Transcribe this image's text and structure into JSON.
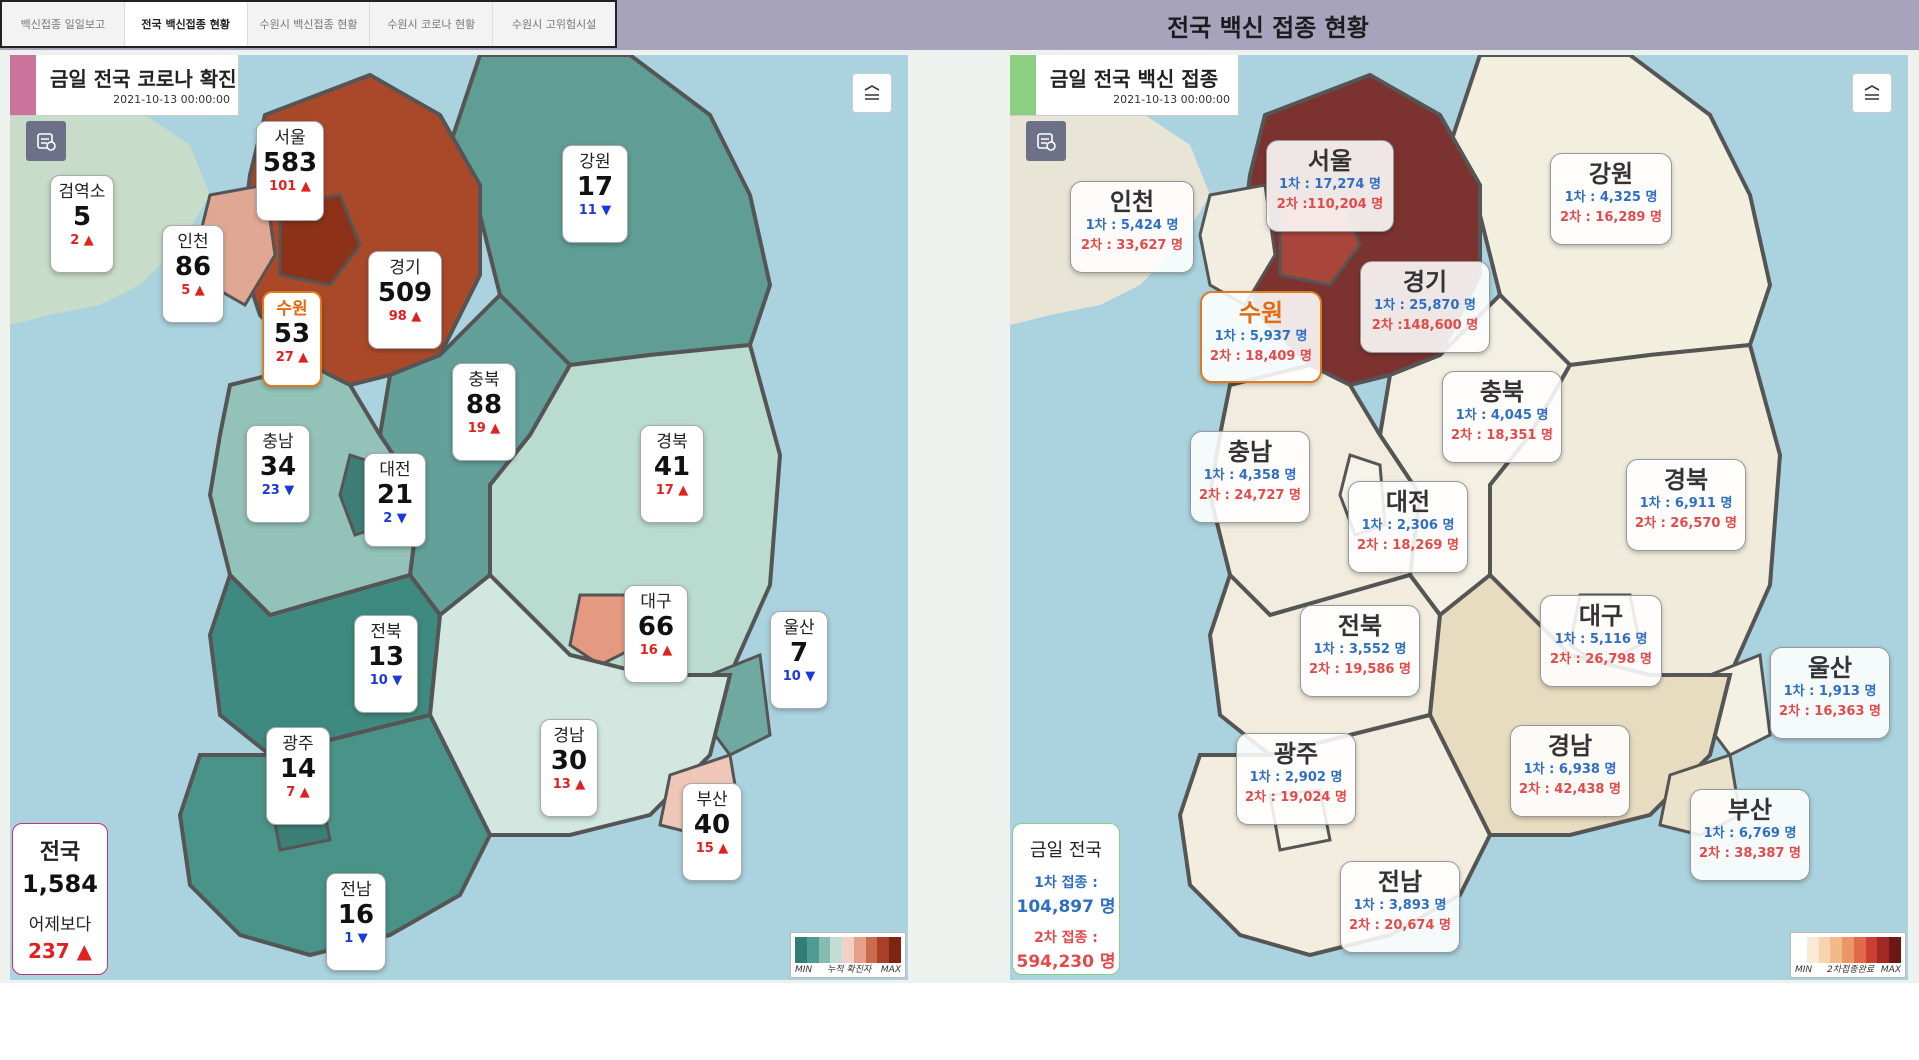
{
  "tabs": [
    {
      "label": "백신접종 일일보고",
      "active": false
    },
    {
      "label": "전국 백신접종 현황",
      "active": true
    },
    {
      "label": "수원시 백신접종 현황",
      "active": false
    },
    {
      "label": "수원시 코로나 현황",
      "active": false
    },
    {
      "label": "수원시 고위험시설",
      "active": false
    }
  ],
  "page_title": "전국 백신 접종 현황",
  "colors": {
    "header_bar": "#a7a3bd",
    "left_accent": "#c9739d",
    "right_accent": "#8ccf82",
    "up": "#e12020",
    "down": "#1a3ad8",
    "dose1": "#2f6fc1",
    "dose2": "#e34a4a",
    "highlight": "#e07a1c"
  },
  "left_panel": {
    "title": "금일 전국 코로나 확진",
    "timestamp": "2021-10-13 00:00:00",
    "legend": {
      "min": "MIN",
      "label": "누적 확진자",
      "max": "MAX"
    },
    "regions": [
      {
        "name": "서울",
        "count": "583",
        "delta": "101",
        "dir": "up"
      },
      {
        "name": "검역소",
        "count": "5",
        "delta": "2",
        "dir": "up"
      },
      {
        "name": "인천",
        "count": "86",
        "delta": "5",
        "dir": "up"
      },
      {
        "name": "수원",
        "count": "53",
        "delta": "27",
        "dir": "up",
        "highlight": true
      },
      {
        "name": "경기",
        "count": "509",
        "delta": "98",
        "dir": "up"
      },
      {
        "name": "강원",
        "count": "17",
        "delta": "11",
        "dir": "down"
      },
      {
        "name": "충북",
        "count": "88",
        "delta": "19",
        "dir": "up"
      },
      {
        "name": "충남",
        "count": "34",
        "delta": "23",
        "dir": "down"
      },
      {
        "name": "대전",
        "count": "21",
        "delta": "2",
        "dir": "down"
      },
      {
        "name": "경북",
        "count": "41",
        "delta": "17",
        "dir": "up"
      },
      {
        "name": "전북",
        "count": "13",
        "delta": "10",
        "dir": "down"
      },
      {
        "name": "대구",
        "count": "66",
        "delta": "16",
        "dir": "up"
      },
      {
        "name": "울산",
        "count": "7",
        "delta": "10",
        "dir": "down"
      },
      {
        "name": "광주",
        "count": "14",
        "delta": "7",
        "dir": "up"
      },
      {
        "name": "경남",
        "count": "30",
        "delta": "13",
        "dir": "up"
      },
      {
        "name": "부산",
        "count": "40",
        "delta": "15",
        "dir": "up"
      },
      {
        "name": "전남",
        "count": "16",
        "delta": "1",
        "dir": "down"
      }
    ],
    "national": {
      "label": "전국",
      "count": "1,584",
      "compare_label": "어제보다",
      "delta": "237",
      "dir": "up"
    }
  },
  "right_panel": {
    "title": "금일 전국 백신 접종",
    "timestamp": "2021-10-13 00:00:00",
    "legend": {
      "min": "MIN",
      "label": "2차접종완료",
      "max": "MAX"
    },
    "regions": [
      {
        "name": "서울",
        "d1": "1차 : 17,274 명",
        "d2": "2차 :110,204 명"
      },
      {
        "name": "인천",
        "d1": "1차 : 5,424 명",
        "d2": "2차 : 33,627 명"
      },
      {
        "name": "강원",
        "d1": "1차 : 4,325 명",
        "d2": "2차 : 16,289 명"
      },
      {
        "name": "경기",
        "d1": "1차 : 25,870 명",
        "d2": "2차 :148,600 명"
      },
      {
        "name": "수원",
        "d1": "1차 : 5,937 명",
        "d2": "2차 : 18,409 명",
        "highlight": true
      },
      {
        "name": "충북",
        "d1": "1차 : 4,045 명",
        "d2": "2차 : 18,351 명"
      },
      {
        "name": "충남",
        "d1": "1차 : 4,358 명",
        "d2": "2차 : 24,727 명"
      },
      {
        "name": "경북",
        "d1": "1차 : 6,911 명",
        "d2": "2차 : 26,570 명"
      },
      {
        "name": "대전",
        "d1": "1차 : 2,306 명",
        "d2": "2차 : 18,269 명"
      },
      {
        "name": "대구",
        "d1": "1차 : 5,116 명",
        "d2": "2차 : 26,798 명"
      },
      {
        "name": "전북",
        "d1": "1차 : 3,552 명",
        "d2": "2차 : 19,586 명"
      },
      {
        "name": "울산",
        "d1": "1차 : 1,913 명",
        "d2": "2차 : 16,363 명"
      },
      {
        "name": "광주",
        "d1": "1차 : 2,902 명",
        "d2": "2차 : 19,024 명"
      },
      {
        "name": "경남",
        "d1": "1차 : 6,938 명",
        "d2": "2차 : 42,438 명"
      },
      {
        "name": "부산",
        "d1": "1차 : 6,769 명",
        "d2": "2차 : 38,387 명"
      },
      {
        "name": "전남",
        "d1": "1차 : 3,893 명",
        "d2": "2차 : 20,674 명"
      }
    ],
    "national": {
      "label": "금일 전국",
      "d1_label": "1차 접종 :",
      "d1": "104,897 명",
      "d2_label": "2차 접종 :",
      "d2": "594,230 명"
    }
  }
}
